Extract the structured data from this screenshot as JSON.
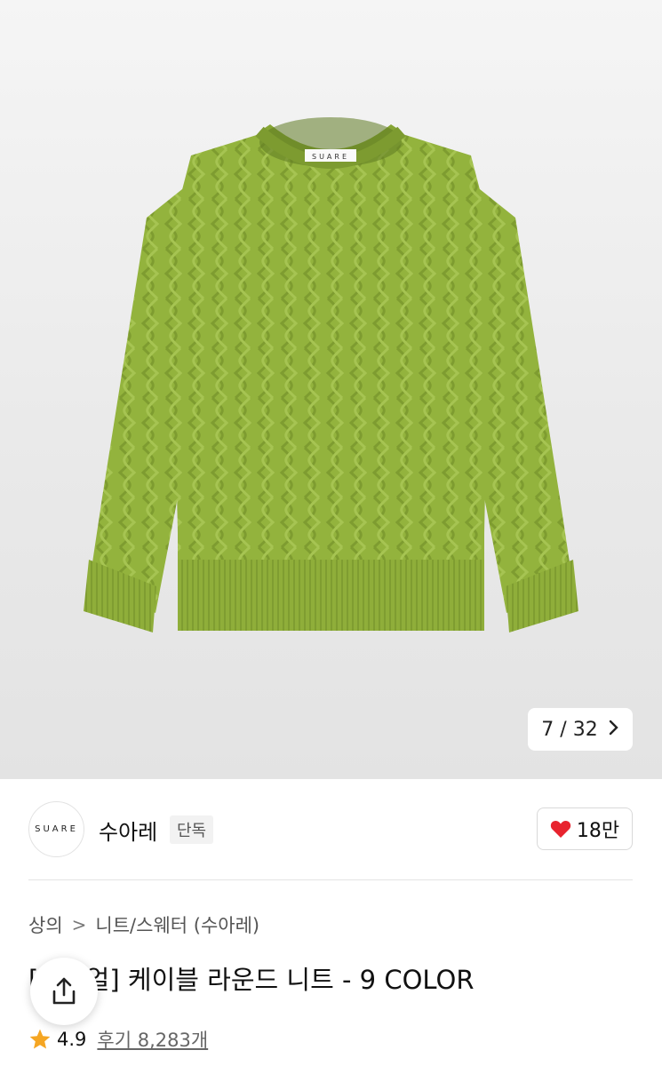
{
  "gallery": {
    "current": "7",
    "separator": "/",
    "total": "32",
    "next_icon": "chevron-right-icon",
    "collar_label": "SUARE"
  },
  "brand": {
    "logo_text": "SUARE",
    "name": "수아레",
    "tag": "단독",
    "likes": "18만",
    "like_icon": "heart-icon",
    "heart_color": "#e8232e"
  },
  "breadcrumb": {
    "items": [
      "상의",
      "니트/스웨터 (수아레)"
    ],
    "separator": ">"
  },
  "product": {
    "title": "[단독얼] 케이블 라운드 니트 - 9 COLOR"
  },
  "rating": {
    "score": "4.9",
    "reviews": "후기 8,283개",
    "star_color": "#f5a623"
  },
  "share": {
    "icon": "share-icon"
  }
}
